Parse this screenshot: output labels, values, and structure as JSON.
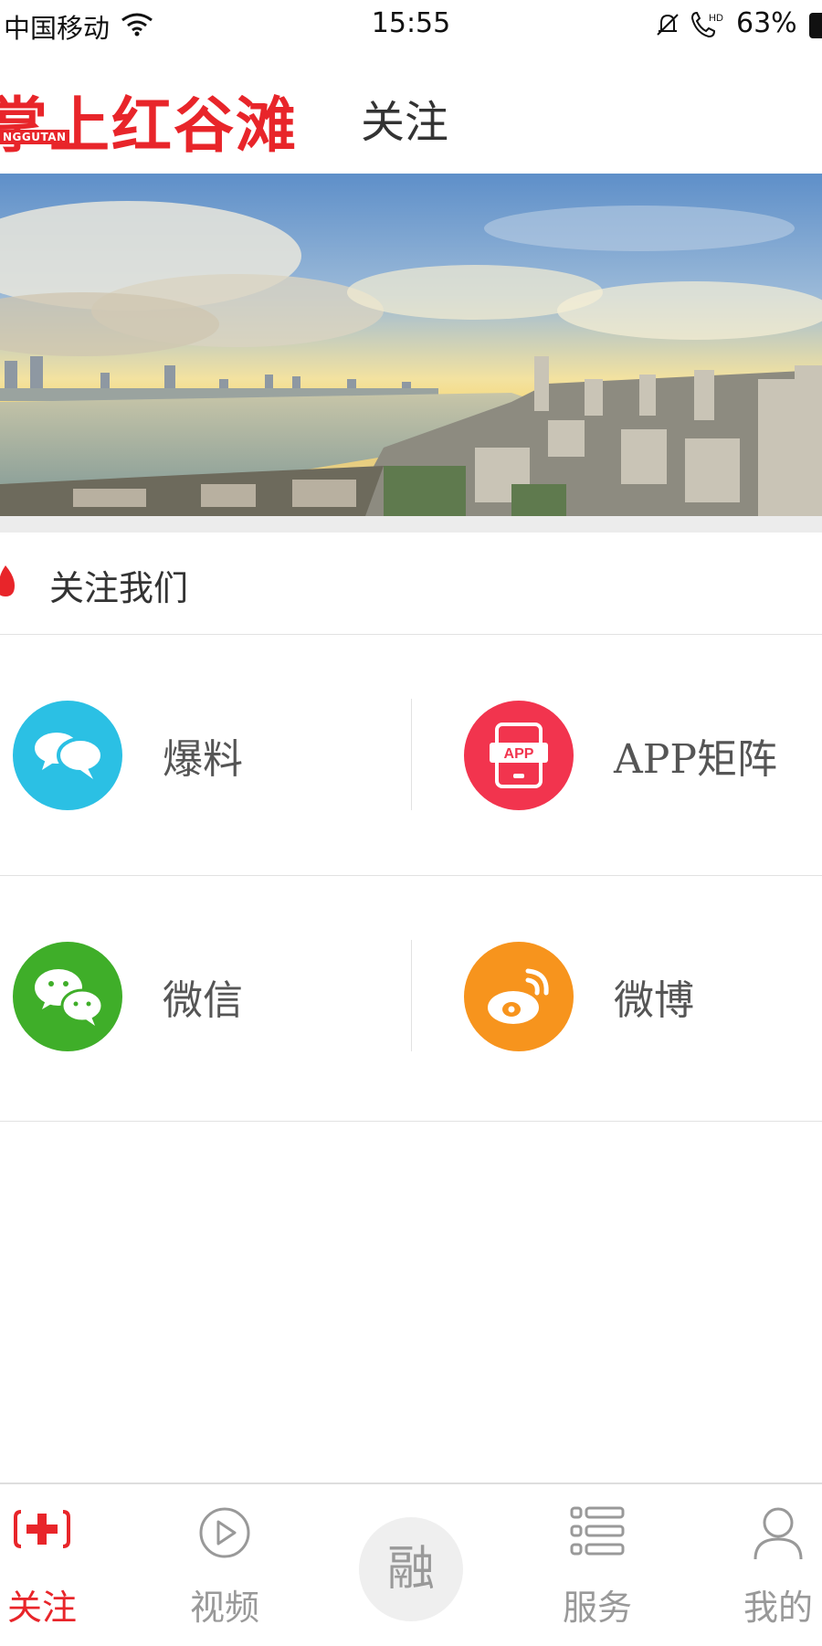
{
  "status_bar": {
    "carrier": "中国移动",
    "time": "15:55",
    "battery": "63%"
  },
  "header": {
    "logo_text": "掌上红谷滩",
    "logo_sub": "NGGUTAN",
    "title": "关注"
  },
  "section": {
    "title": "关注我们"
  },
  "grid": {
    "items": [
      {
        "label": "爆料",
        "icon": "chat-bubbles-icon",
        "color": "#2bc0e4"
      },
      {
        "label": "APP矩阵",
        "icon": "app-phone-icon",
        "color": "#f2344e"
      },
      {
        "label": "微信",
        "icon": "wechat-icon",
        "color": "#3fae29"
      },
      {
        "label": "微博",
        "icon": "weibo-icon",
        "color": "#f7941d"
      }
    ]
  },
  "tabbar": {
    "tabs": [
      {
        "label": "关注",
        "icon": "cross-plus-icon",
        "active": true
      },
      {
        "label": "视频",
        "icon": "play-circle-icon",
        "active": false
      },
      {
        "label": "融",
        "icon": "fuse-center-icon",
        "active": false
      },
      {
        "label": "服务",
        "icon": "list-icon",
        "active": false
      },
      {
        "label": "我的",
        "icon": "user-icon",
        "active": false
      }
    ]
  },
  "colors": {
    "brand_red": "#e8252a",
    "divider": "#e2e2e2",
    "tab_inactive": "#999999"
  }
}
